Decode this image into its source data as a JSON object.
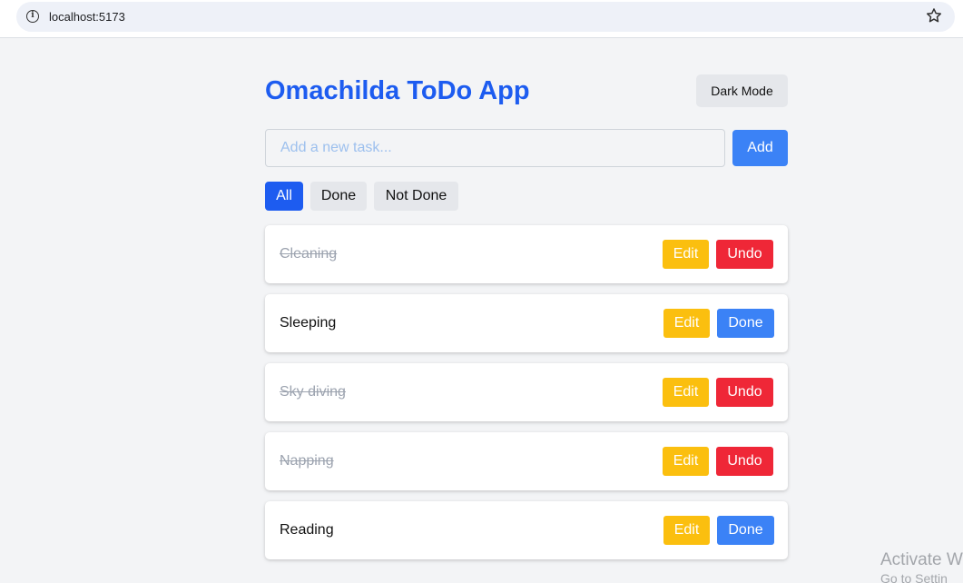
{
  "browser": {
    "url": "localhost:5173"
  },
  "app": {
    "title": "Omachilda ToDo App",
    "dark_mode_label": "Dark Mode",
    "input_placeholder": "Add a new task...",
    "add_label": "Add"
  },
  "filters": [
    {
      "label": "All",
      "active": true
    },
    {
      "label": "Done",
      "active": false
    },
    {
      "label": "Not Done",
      "active": false
    }
  ],
  "tasks": [
    {
      "text": "Cleaning",
      "completed": true,
      "edit_label": "Edit",
      "action_label": "Undo"
    },
    {
      "text": "Sleeping",
      "completed": false,
      "edit_label": "Edit",
      "action_label": "Done"
    },
    {
      "text": "Sky diving",
      "completed": true,
      "edit_label": "Edit",
      "action_label": "Undo"
    },
    {
      "text": "Napping",
      "completed": true,
      "edit_label": "Edit",
      "action_label": "Undo"
    },
    {
      "text": "Reading",
      "completed": false,
      "edit_label": "Edit",
      "action_label": "Done"
    }
  ],
  "watermark": {
    "line1": "Activate W",
    "line2": "Go to Settin"
  },
  "colors": {
    "title": "#1d5cf0",
    "primary": "#3b82f6",
    "active_filter": "#1d5cf0",
    "edit": "#fbbf0f",
    "undo": "#ef2737",
    "completed_text": "#9ca3af"
  }
}
